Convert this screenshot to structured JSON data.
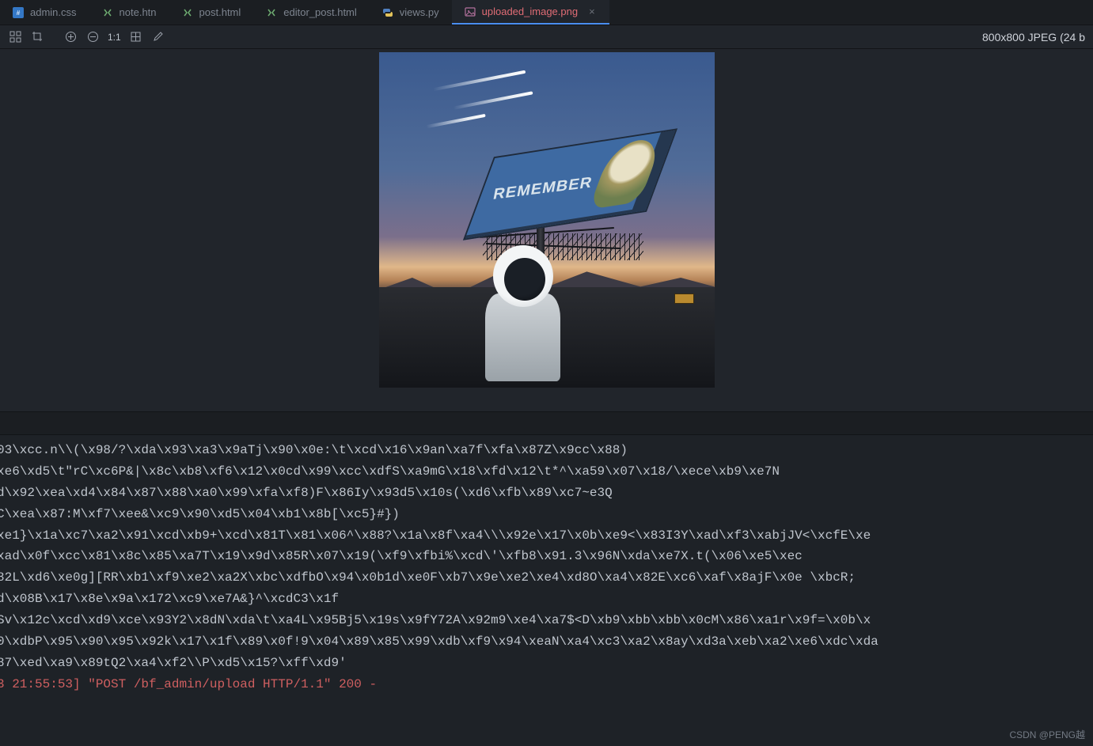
{
  "tabs": [
    {
      "label": "admin.css",
      "icon": "css",
      "active": false
    },
    {
      "label": "note.htn",
      "icon": "html",
      "active": false
    },
    {
      "label": "post.html",
      "icon": "html",
      "active": false
    },
    {
      "label": "editor_post.html",
      "icon": "html",
      "active": false
    },
    {
      "label": "views.py",
      "icon": "python",
      "active": false
    },
    {
      "label": "uploaded_image.png",
      "icon": "image",
      "active": true
    }
  ],
  "toolbar": {
    "ratio_label": "1:1"
  },
  "image_meta": "800x800 JPEG (24 b",
  "billboard_text": "REMEMBER",
  "terminal_lines": [
    "03\\xcc.n\\\\(\\x98/?\\xda\\x93\\xa3\\x9aTj\\x90\\x0e:\\t\\xcd\\x16\\x9an\\xa7f\\xfa\\x87Z\\x9cc\\x88)",
    "xe6\\xd5\\t\"rC\\xc6P&|\\x8c\\xb8\\xf6\\x12\\x0cd\\x99\\xcc\\xdfS\\xa9mG\\x18\\xfd\\x12\\t*^\\xa59\\x07\\x18/\\xece\\xb9\\xe7N",
    "d\\x92\\xea\\xd4\\x84\\x87\\x88\\xa0\\x99\\xfa\\xf8)F\\x86Iy\\x93d5\\x10s(\\xd6\\xfb\\x89\\xc7~e3Q",
    "C\\xea\\x87:M\\xf7\\xee&\\xc9\\x90\\xd5\\x04\\xb1\\x8b[\\xc5}#})",
    "xe1}\\x1a\\xc7\\xa2\\x91\\xcd\\xb9+\\xcd\\x81T\\x81\\x06^\\x88?\\x1a\\x8f\\xa4\\\\\\x92e\\x17\\x0b\\xe9<\\x83I3Y\\xad\\xf3\\xabjJV<\\xcfE\\xe",
    "xad\\x0f\\xcc\\x81\\x8c\\x85\\xa7T\\x19\\x9d\\x85R\\x07\\x19(\\xf9\\xfbi%\\xcd\\'\\xfb8\\x91.3\\x96N\\xda\\xe7X.t(\\x06\\xe5\\xec",
    "82L\\xd6\\xe0g][RR\\xb1\\xf9\\xe2\\xa2X\\xbc\\xdfbO\\x94\\x0b1d\\xe0F\\xb7\\x9e\\xe2\\xe4\\xd8O\\xa4\\x82E\\xc6\\xaf\\x8ajF\\x0e \\xbcR;",
    "d\\x08B\\x17\\x8e\\x9a\\x172\\xc9\\xe7A&}^\\xcdC3\\x1f",
    "Sv\\x12c\\xcd\\xd9\\xce\\x93Y2\\x8dN\\xda\\t\\xa4L\\x95Bj5\\x19s\\x9fY72A\\x92m9\\xe4\\xa7$<D\\xb9\\xbb\\xbb\\x0cM\\x86\\xa1r\\x9f=\\x0b\\x",
    "0\\xdbP\\x95\\x90\\x95\\x92k\\x17\\x1f\\x89\\x0f!9\\x04\\x89\\x85\\x99\\xdb\\xf9\\x94\\xeaN\\xa4\\xc3\\xa2\\x8ay\\xd3a\\xeb\\xa2\\xe6\\xdc\\xda",
    "87\\xed\\xa9\\x89tQ2\\xa4\\xf2\\\\P\\xd5\\x15?\\xff\\xd9'"
  ],
  "terminal_status": "3 21:55:53] \"POST /bf_admin/upload HTTP/1.1\" 200 -",
  "watermark": "CSDN @PENG越"
}
